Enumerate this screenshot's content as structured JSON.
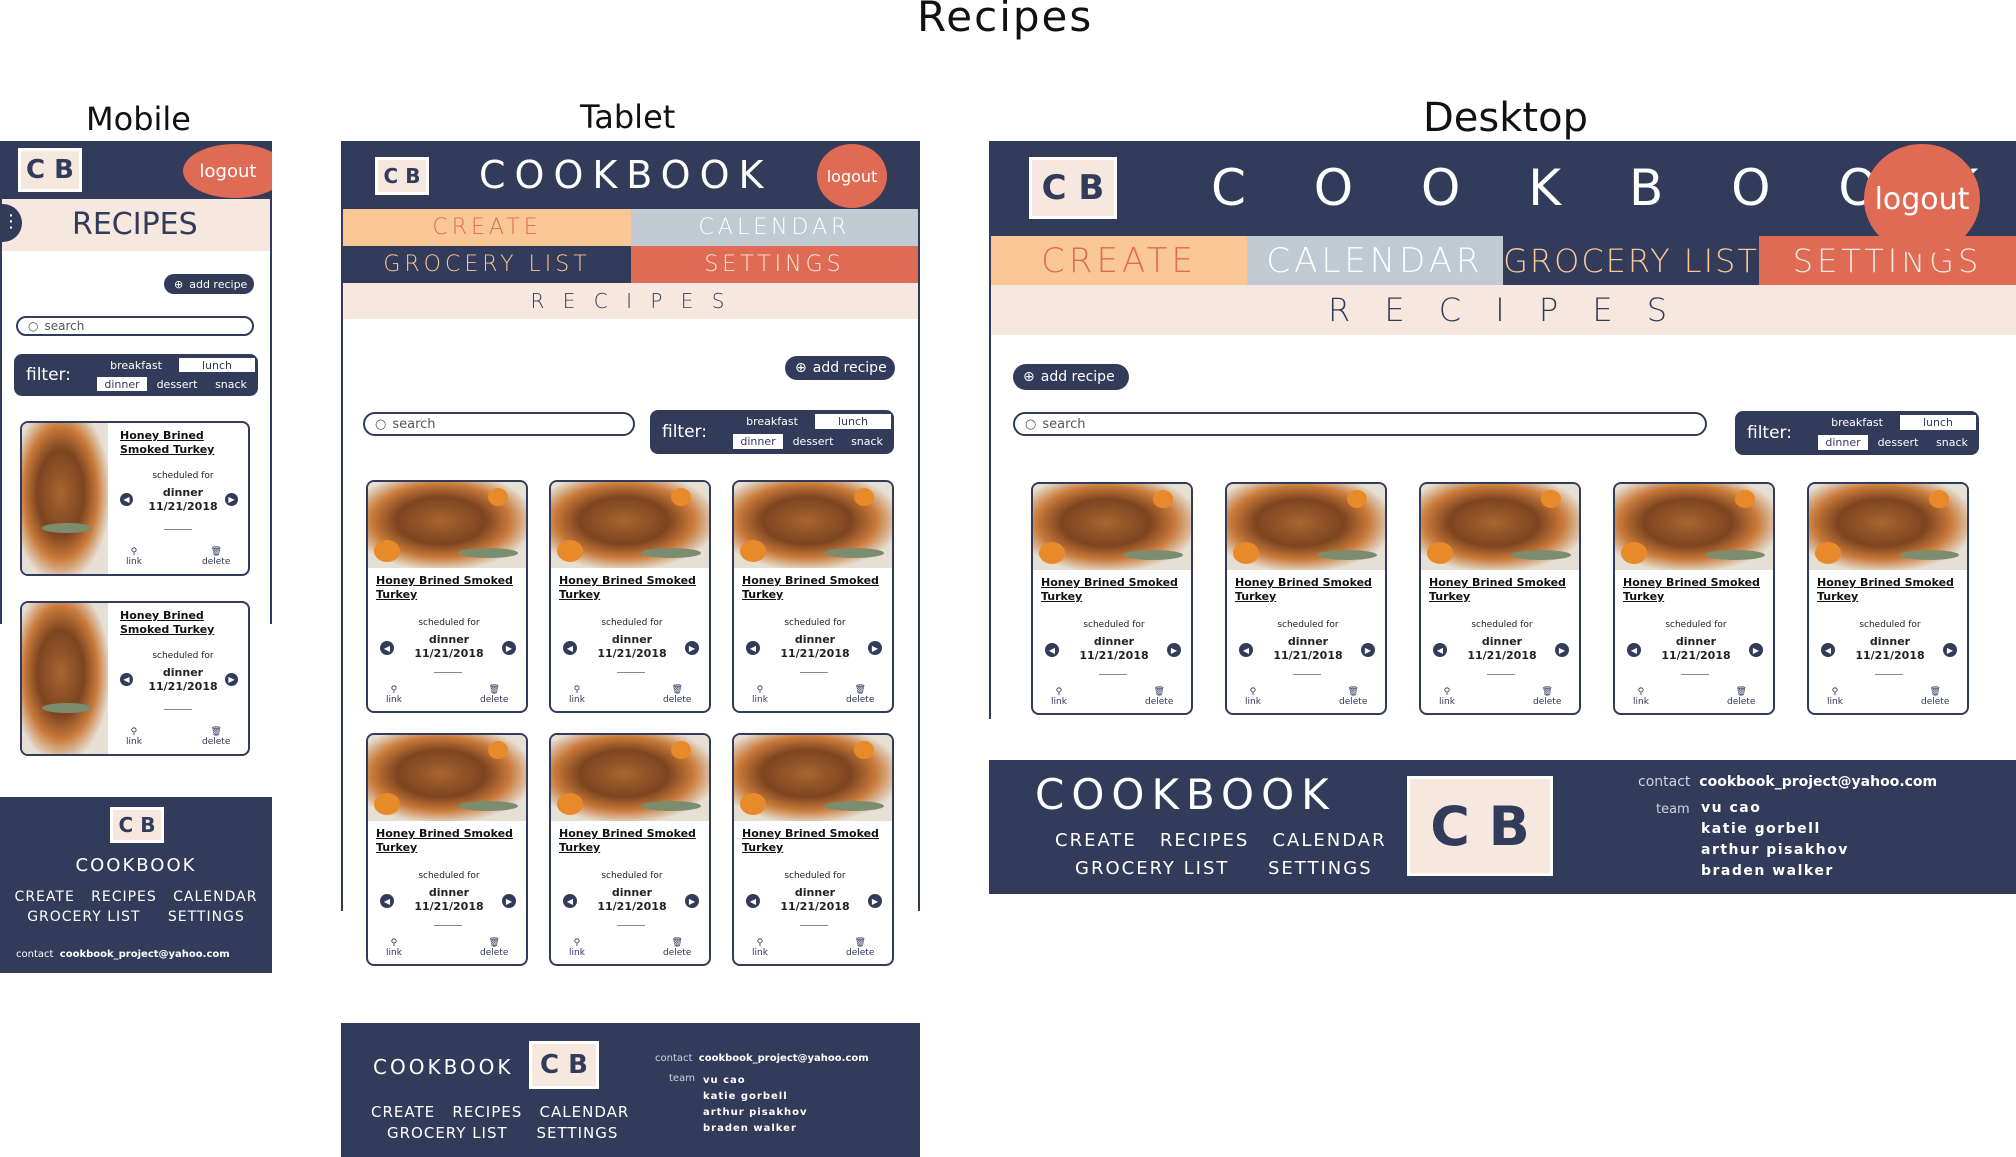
{
  "page_title": "Recipes",
  "labels": {
    "mobile": "Mobile",
    "tablet": "Tablet",
    "desktop": "Desktop"
  },
  "logo_text": "C B",
  "brand": "COOKBOOK",
  "brand_spaced": "C O O K B O O K",
  "logout": "logout",
  "nav": {
    "create": "CREATE",
    "calendar": "CALENDAR",
    "grocery": "GROCERY LIST",
    "settings": "SETTINGS"
  },
  "mobile_recipes_title": "RECIPES",
  "recipes_banner": "R E C I P E S",
  "add_recipe": "add recipe",
  "search_placeholder": "search",
  "filter": {
    "label": "filter:",
    "options": [
      "breakfast",
      "lunch",
      "dinner",
      "dessert",
      "snack"
    ]
  },
  "card": {
    "title": "Honey Brined Smoked Turkey",
    "title_mobile_1": "Honey Brined",
    "title_mobile_2": "Smoked Turkey",
    "title_tab_1": "Honey Brined Smoked",
    "title_tab_2": "Turkey",
    "scheduled": "scheduled for",
    "meal": "dinner",
    "date": "11/21/2018",
    "link": "link",
    "delete": "delete"
  },
  "footer": {
    "nav_row1": "CREATE   RECIPES   CALENDAR",
    "nav_row2": "GROCERY LIST     SETTINGS",
    "contact_label": "contact",
    "email": "cookbook_project@yahoo.com",
    "team_label": "team",
    "team": [
      "vu cao",
      "katie gorbell",
      "arthur pisakhov",
      "braden walker"
    ]
  },
  "colors": {
    "navy": "#323b5a",
    "orange": "#f9c794",
    "red": "#df6b55",
    "blue_grey": "#bfcad3",
    "cream": "#f6e8df"
  },
  "icons": [
    "search-icon",
    "plus-icon",
    "link-icon",
    "trash-icon",
    "chevron-left-icon",
    "chevron-right-icon",
    "menu-dots-icon"
  ]
}
